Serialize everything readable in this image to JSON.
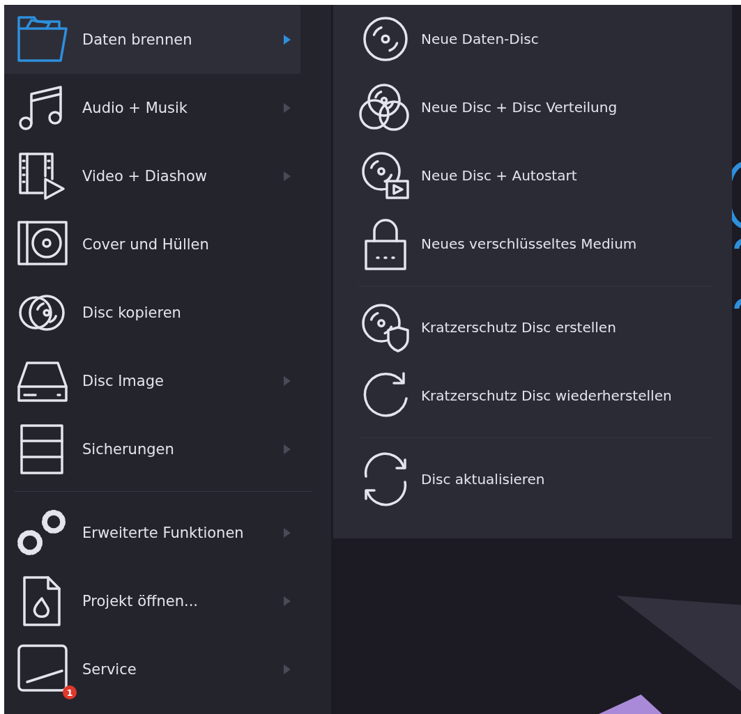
{
  "menu": {
    "groups": [
      [
        {
          "label": "Daten brennen",
          "selected": true,
          "has_submenu": true
        },
        {
          "label": "Audio + Musik",
          "selected": false,
          "has_submenu": true
        },
        {
          "label": "Video + Diashow",
          "selected": false,
          "has_submenu": true
        },
        {
          "label": "Cover und Hüllen",
          "selected": false,
          "has_submenu": false
        },
        {
          "label": "Disc kopieren",
          "selected": false,
          "has_submenu": false
        },
        {
          "label": "Disc Image",
          "selected": false,
          "has_submenu": true
        },
        {
          "label": "Sicherungen",
          "selected": false,
          "has_submenu": true
        }
      ],
      [
        {
          "label": "Erweiterte Funktionen",
          "selected": false,
          "has_submenu": true
        },
        {
          "label": "Projekt öffnen...",
          "selected": false,
          "has_submenu": true
        },
        {
          "label": "Service",
          "selected": false,
          "has_submenu": true,
          "badge": "1"
        }
      ]
    ]
  },
  "submenu": {
    "groups": [
      [
        {
          "label": "Neue Daten-Disc"
        },
        {
          "label": "Neue Disc + Disc Verteilung"
        },
        {
          "label": "Neue Disc + Autostart"
        },
        {
          "label": "Neues verschlüsseltes Medium"
        }
      ],
      [
        {
          "label": "Kratzerschutz Disc erstellen"
        },
        {
          "label": "Kratzerschutz Disc wiederherstellen"
        }
      ],
      [
        {
          "label": "Disc aktualisieren"
        }
      ]
    ]
  }
}
